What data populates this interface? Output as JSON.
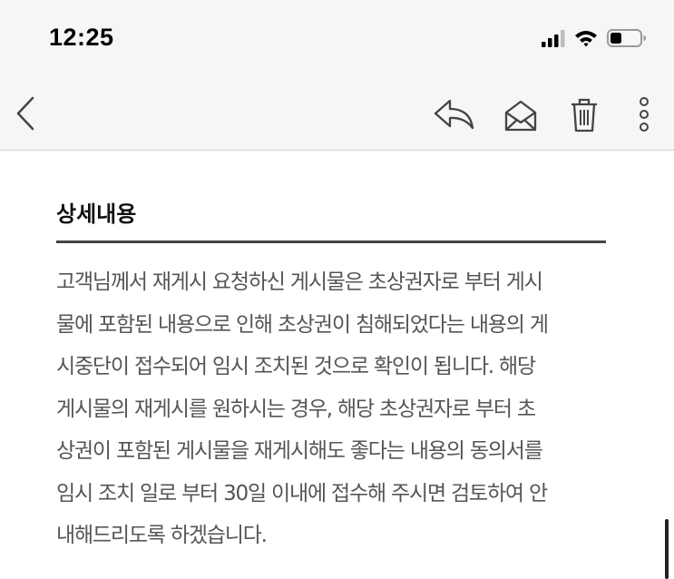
{
  "status_bar": {
    "time": "12:25",
    "signal_icon": "cellular-signal-icon",
    "wifi_icon": "wifi-icon",
    "battery_icon": "battery-icon",
    "battery_level": 0.35
  },
  "toolbar": {
    "back_icon": "chevron-left-icon",
    "reply_icon": "reply-icon",
    "mark_read_icon": "open-envelope-icon",
    "delete_icon": "trash-icon",
    "more_icon": "more-vertical-icon"
  },
  "content": {
    "section_title": "상세내용",
    "body_text": "고객님께서 재게시 요청하신 게시물은 초상권자로 부터 게시\n물에 포함된 내용으로 인해 초상권이 침해되었다는 내용의 게\n시중단이 접수되어 임시 조치된 것으로 확인이 됩니다. 해당\n게시물의 재게시를 원하시는 경우, 해당 초상권자로 부터 초\n상권이 포함된 게시물을 재게시해도 좋다는 내용의 동의서를\n임시 조치 일로 부터 30일 이내에 접수해 주시면 검토하여 안\n내해드리도록 하겠습니다."
  }
}
